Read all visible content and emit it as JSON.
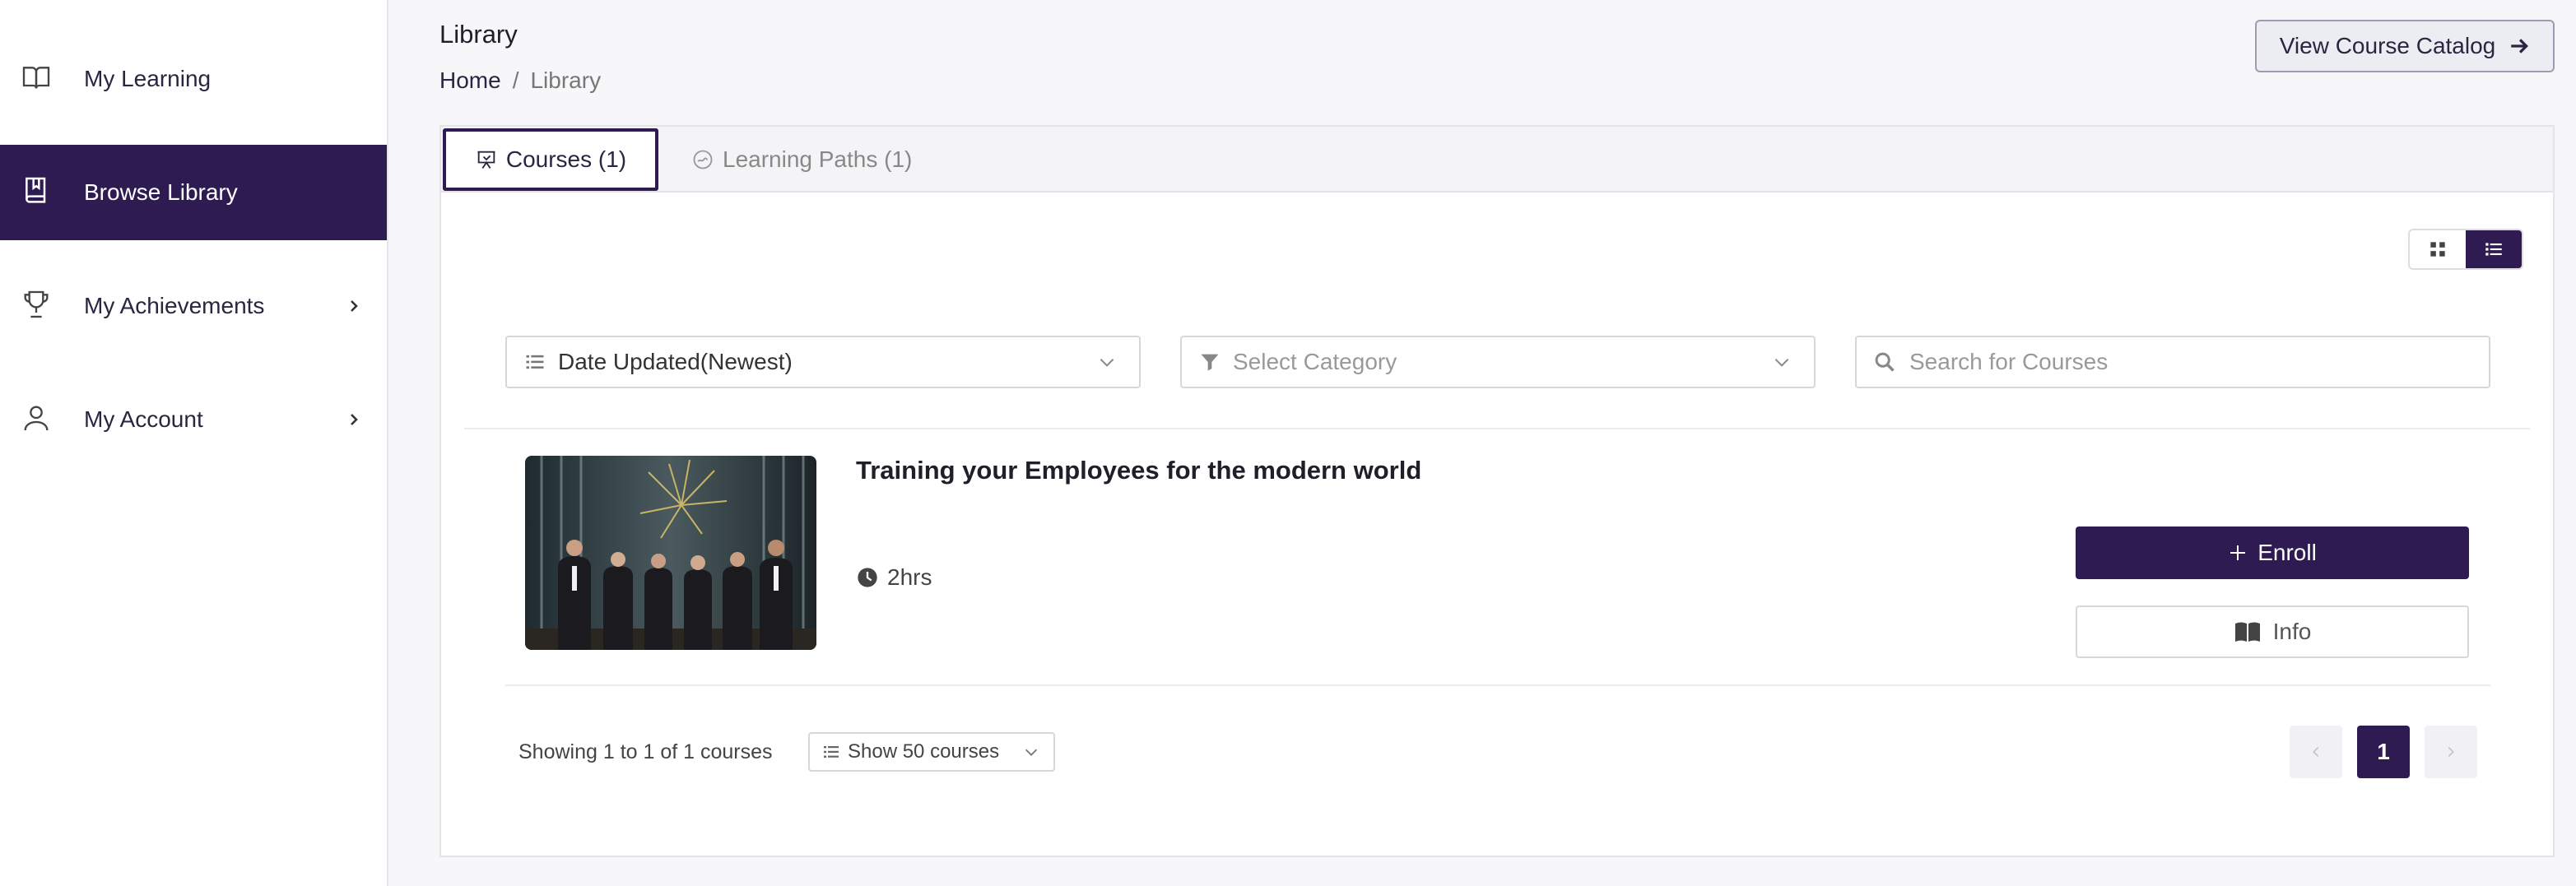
{
  "sidebar": {
    "items": [
      {
        "label": "My Learning",
        "icon": "book-open-icon"
      },
      {
        "label": "Browse Library",
        "icon": "library-book-icon",
        "active": true
      },
      {
        "label": "My Achievements",
        "icon": "trophy-icon",
        "has_submenu": true
      },
      {
        "label": "My Account",
        "icon": "user-icon",
        "has_submenu": true
      }
    ]
  },
  "header": {
    "title": "Library",
    "breadcrumb": {
      "home": "Home",
      "separator": "/",
      "current": "Library"
    },
    "catalog_button": "View Course Catalog"
  },
  "tabs": [
    {
      "label": "Courses (1)",
      "active": true
    },
    {
      "label": "Learning Paths (1)",
      "active": false
    }
  ],
  "view_toggle": {
    "selected": "list"
  },
  "filters": {
    "sort": {
      "value": "Date Updated(Newest)"
    },
    "category": {
      "placeholder": "Select Category"
    },
    "search": {
      "placeholder": "Search for Courses"
    }
  },
  "course": {
    "title": "Training your Employees for the modern world",
    "duration": "2hrs",
    "enroll_label": "Enroll",
    "info_label": "Info"
  },
  "footer": {
    "showing": "Showing 1 to 1 of 1 courses",
    "per_page": "Show 50 courses",
    "current_page": "1"
  },
  "colors": {
    "accent": "#2d1b52",
    "background": "#f7f7f9",
    "border": "#d6d6dc"
  }
}
